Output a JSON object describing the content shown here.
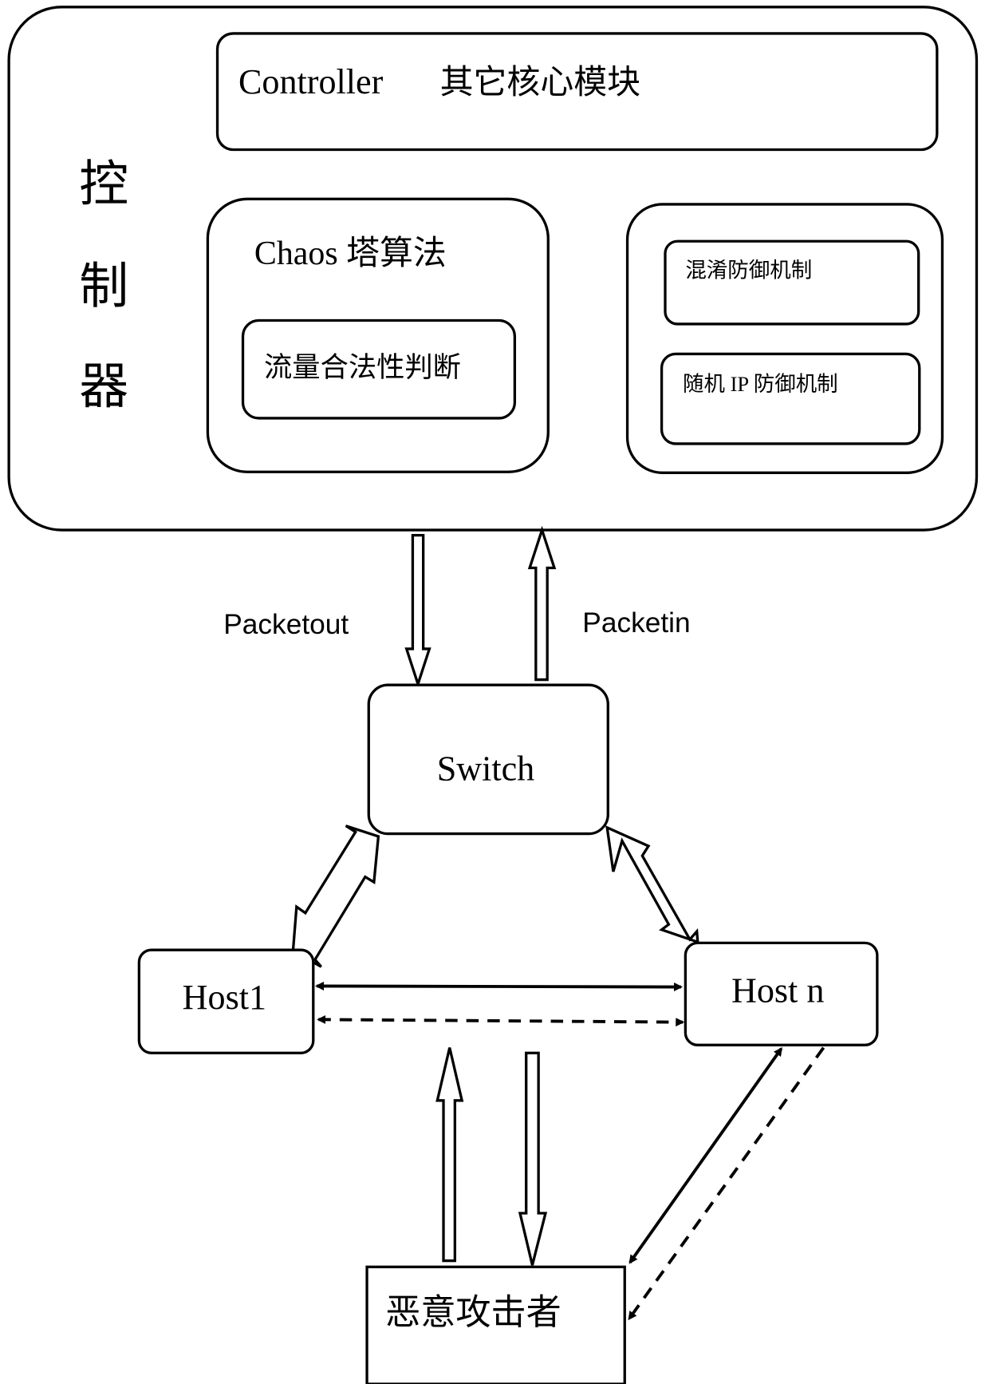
{
  "colors": {
    "stroke": "#000000",
    "background": "#ffffff"
  },
  "controller": {
    "vertical_label": [
      "控",
      "制",
      "器"
    ],
    "core_module": {
      "label_en": "Controller",
      "label_zh": "其它核心模块"
    },
    "chaos": {
      "title": "Chaos 塔算法",
      "sub_module": "流量合法性判断"
    },
    "defense": {
      "items": [
        "混淆防御机制",
        "随机 IP 防御机制"
      ]
    }
  },
  "links": {
    "packetout": "Packetout",
    "packetin": "Packetin"
  },
  "nodes": {
    "switch": "Switch",
    "host1": "Host1",
    "hostn": "Host n",
    "attacker": "恶意攻击者"
  }
}
